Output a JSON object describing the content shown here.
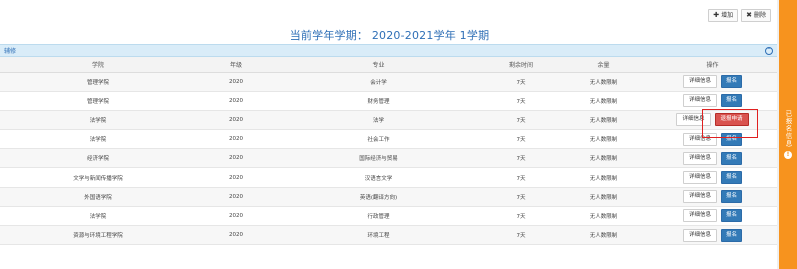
{
  "toolbar": {
    "add_label": "增加",
    "delete_label": "删除"
  },
  "title": "当前学年学期： 2020-2021学年 1学期",
  "panel": {
    "label": "辅修"
  },
  "table": {
    "headers": [
      "学院",
      "年级",
      "专业",
      "剩余时间",
      "余量",
      "操作"
    ],
    "detail_label": "详细信息",
    "enroll_label": "报名",
    "withdraw_label": "退报申请",
    "rows": [
      {
        "college": "管理学院",
        "grade": "2020",
        "major": "会计学",
        "time": "7天",
        "quota": "无人数限制",
        "status": "enroll"
      },
      {
        "college": "管理学院",
        "grade": "2020",
        "major": "财务管理",
        "time": "7天",
        "quota": "无人数限制",
        "status": "enroll"
      },
      {
        "college": "法学院",
        "grade": "2020",
        "major": "法学",
        "time": "7天",
        "quota": "无人数限制",
        "status": "withdraw"
      },
      {
        "college": "法学院",
        "grade": "2020",
        "major": "社会工作",
        "time": "7天",
        "quota": "无人数限制",
        "status": "enroll"
      },
      {
        "college": "经济学院",
        "grade": "2020",
        "major": "国际经济与贸易",
        "time": "7天",
        "quota": "无人数限制",
        "status": "enroll"
      },
      {
        "college": "文学与新闻传播学院",
        "grade": "2020",
        "major": "汉语言文学",
        "time": "7天",
        "quota": "无人数限制",
        "status": "enroll"
      },
      {
        "college": "外国语学院",
        "grade": "2020",
        "major": "英语(翻译方向)",
        "time": "7天",
        "quota": "无人数限制",
        "status": "enroll"
      },
      {
        "college": "法学院",
        "grade": "2020",
        "major": "行政管理",
        "time": "7天",
        "quota": "无人数限制",
        "status": "enroll"
      },
      {
        "college": "资源与环境工程学院",
        "grade": "2020",
        "major": "环境工程",
        "time": "7天",
        "quota": "无人数限制",
        "status": "enroll"
      }
    ]
  },
  "sidebar": {
    "label": "已报名信息"
  },
  "colors": {
    "accent": "#2f6fb6",
    "enroll": "#337ab7",
    "withdraw": "#d9534f",
    "sidebar": "#f7931e"
  }
}
